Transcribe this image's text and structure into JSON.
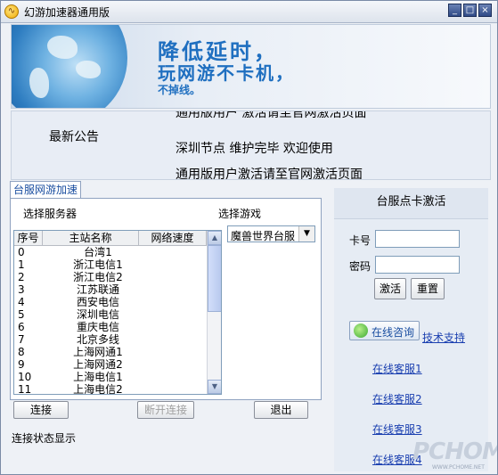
{
  "window": {
    "title": "幻游加速器通用版",
    "controls": [
      "_",
      "□",
      "×"
    ]
  },
  "banner": {
    "line1": "降低延时，",
    "line2": "玩网游不卡机，",
    "line3": "不掉线。"
  },
  "notice": {
    "label": "最新公告",
    "lines": [
      "通用版用户 激活请至官网激活页面",
      "深圳节点  维护完毕  欢迎使用",
      "通用版用户激活请至官网激活页面"
    ]
  },
  "tab": {
    "label": "台服网游加速"
  },
  "server": {
    "label": "选择服务器",
    "columns": [
      "序号",
      "主站名称",
      "网络速度"
    ],
    "rows": [
      {
        "no": "0",
        "name": "台湾1"
      },
      {
        "no": "1",
        "name": "浙江电信1"
      },
      {
        "no": "2",
        "name": "浙江电信2"
      },
      {
        "no": "3",
        "name": "江苏联通"
      },
      {
        "no": "4",
        "name": "西安电信"
      },
      {
        "no": "5",
        "name": "深圳电信"
      },
      {
        "no": "6",
        "name": "重庆电信"
      },
      {
        "no": "7",
        "name": "北京多线"
      },
      {
        "no": "8",
        "name": "上海网通1"
      },
      {
        "no": "9",
        "name": "上海网通2"
      },
      {
        "no": "10",
        "name": "上海电信1"
      },
      {
        "no": "11",
        "name": "上海电信2"
      }
    ]
  },
  "game": {
    "label": "选择游戏",
    "selected": "魔兽世界台服"
  },
  "buttons": {
    "connect": "连接",
    "disconnect": "断开连接",
    "exit": "退出"
  },
  "status": {
    "text": "连接状态显示"
  },
  "activation": {
    "title": "台服点卡激活",
    "card_label": "卡号",
    "password_label": "密码",
    "activate": "激活",
    "reset": "重置"
  },
  "support": {
    "consult": "在线咨询",
    "tech": "技术支持",
    "links": [
      "在线客服1",
      "在线客服2",
      "在线客服3",
      "在线客服4"
    ]
  },
  "watermark": {
    "brand": "PCHOME",
    "url": "WWW.PCHOME.NET"
  }
}
